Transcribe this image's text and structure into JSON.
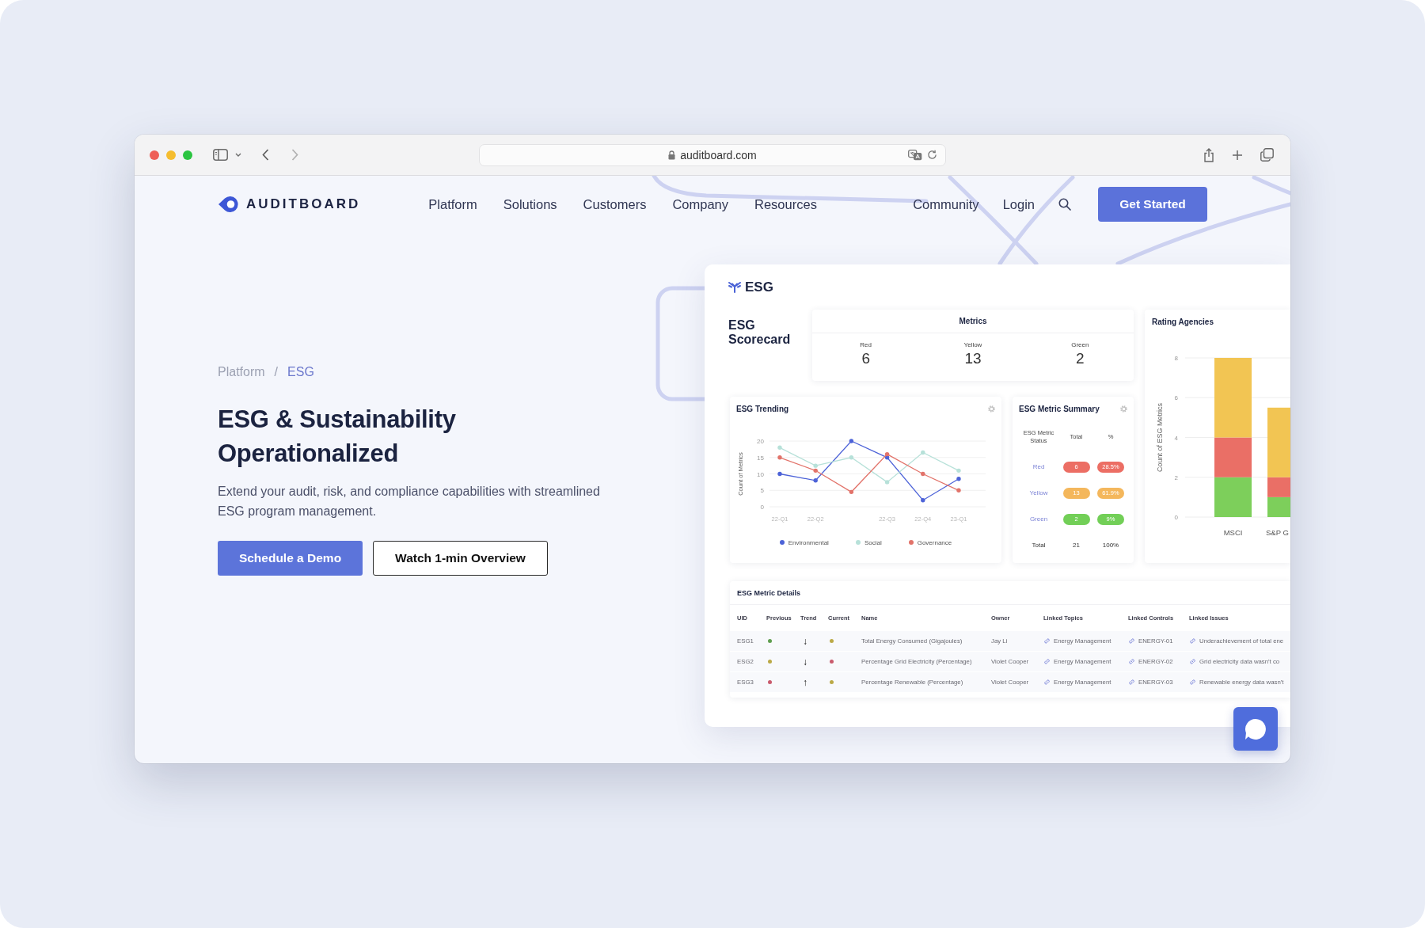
{
  "browser": {
    "url": "auditboard.com",
    "back_disabled": false,
    "forward_disabled": true
  },
  "nav": {
    "logo": "AUDITBOARD",
    "links": [
      "Platform",
      "Solutions",
      "Customers",
      "Company",
      "Resources"
    ],
    "right_links": [
      "Community",
      "Login"
    ],
    "cta": "Get Started"
  },
  "hero": {
    "breadcrumb": [
      {
        "label": "Platform",
        "current": false
      },
      {
        "label": "ESG",
        "current": true
      }
    ],
    "separator": "/",
    "title": "ESG & Sustainability Operationalized",
    "text": "Extend your audit, risk, and compliance capabilities with streamlined ESG program management.",
    "buttons": [
      {
        "label": "Schedule a Demo",
        "kind": "primary"
      },
      {
        "label": "Watch 1-min Overview",
        "kind": "outline"
      }
    ]
  },
  "dashboard": {
    "title": "ESG",
    "scorecard_title": "ESG Scorecard",
    "metrics": {
      "title": "Metrics",
      "items": [
        {
          "label": "Red",
          "value": "6"
        },
        {
          "label": "Yellow",
          "value": "13"
        },
        {
          "label": "Green",
          "value": "2"
        }
      ]
    },
    "rating_agencies": {
      "title": "Rating Agencies",
      "chart_data": {
        "type": "bar",
        "stacked": true,
        "grid": true,
        "ylabel": "Count of ESG Metrics",
        "categories": [
          "MSCI",
          "S&P G"
        ],
        "series": [
          {
            "color": "#7dcf5b",
            "values": [
              2,
              1
            ]
          },
          {
            "color": "#ea6f66",
            "values": [
              2,
              1
            ]
          },
          {
            "color": "#f2c553",
            "values": [
              4,
              3.5
            ]
          }
        ],
        "ylim": [
          0,
          8
        ],
        "yticks": [
          0,
          2,
          4,
          6,
          8
        ]
      }
    },
    "trending": {
      "title": "ESG Trending",
      "chart_data": {
        "type": "line",
        "grid": true,
        "ylabel": "Count of Metrics",
        "categories": [
          "22-Q1",
          "22-Q2",
          null,
          "22-Q3",
          "22-Q4",
          "23-Q1"
        ],
        "ylim": [
          0,
          20
        ],
        "yticks": [
          0,
          5,
          10,
          15,
          20
        ],
        "series": [
          {
            "name": "Environmental",
            "color": "#4d63d8",
            "values": [
              10,
              8,
              20,
              15,
              2,
              8.5
            ]
          },
          {
            "name": "Social",
            "color": "#b7e1d9",
            "values": [
              18,
              12.5,
              15,
              7.5,
              16.5,
              11
            ]
          },
          {
            "name": "Governance",
            "color": "#e2736a",
            "values": [
              15,
              11,
              4.5,
              16,
              10,
              5
            ]
          }
        ]
      }
    },
    "summary": {
      "title": "ESG Metric Summary",
      "columns": [
        "ESG Metric Status",
        "Total",
        "%"
      ],
      "rows": [
        {
          "label": "Red",
          "total": "6",
          "percent": "28.5%",
          "color": "#ec6e64"
        },
        {
          "label": "Yellow",
          "total": "13",
          "percent": "61.9%",
          "color": "#f4b75c"
        },
        {
          "label": "Green",
          "total": "2",
          "percent": "9%",
          "color": "#72cf57"
        }
      ],
      "total_row": {
        "label": "Total",
        "total": "21",
        "percent": "100%"
      }
    },
    "details": {
      "title": "ESG Metric Details",
      "columns": [
        "UID",
        "Previous",
        "Trend",
        "Current",
        "Name",
        "Owner",
        "Linked Topics",
        "Linked Controls",
        "Linked Issues"
      ],
      "rows": [
        {
          "uid": "ESG1",
          "previous": {
            "color": "#5f9e4f"
          },
          "trend": "↓",
          "current": {
            "color": "#bba946"
          },
          "name": "Total Energy Consumed (Gigajoules)",
          "owner": "Jay Li",
          "topic": "Energy Management",
          "control": "ENERGY-01",
          "issue": "Underachievement of total ene"
        },
        {
          "uid": "ESG2",
          "previous": {
            "color": "#bba946"
          },
          "trend": "↓",
          "current": {
            "color": "#c95a6c"
          },
          "name": "Percentage Grid Electricity (Percentage)",
          "owner": "Violet Cooper",
          "topic": "Energy Management",
          "control": "ENERGY-02",
          "issue": "Grid electricity data wasn't co"
        },
        {
          "uid": "ESG3",
          "previous": {
            "color": "#c95a6c"
          },
          "trend": "↑",
          "current": {
            "color": "#bba946"
          },
          "name": "Percentage Renewable (Percentage)",
          "owner": "Violet Cooper",
          "topic": "Energy Management",
          "control": "ENERGY-03",
          "issue": "Renewable energy data wasn't"
        }
      ]
    }
  }
}
